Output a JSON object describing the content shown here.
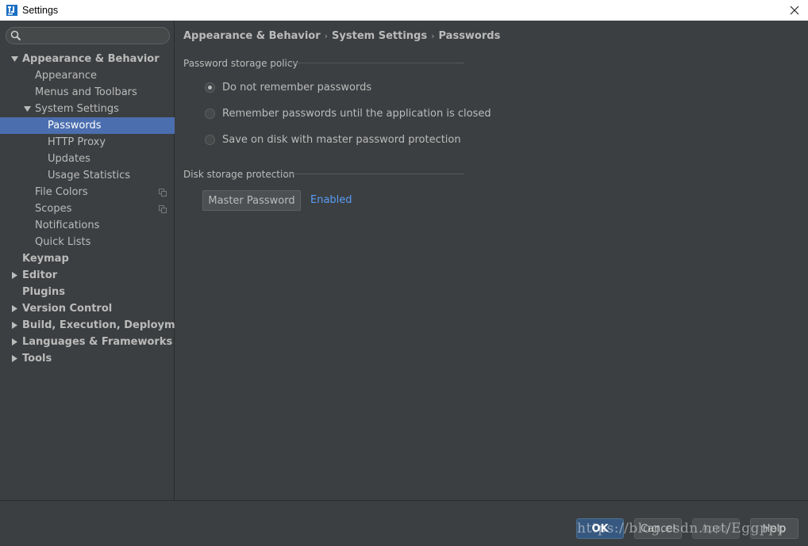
{
  "window": {
    "title": "Settings",
    "logo_icon": "intellij-logo-icon",
    "close_icon": "close-icon"
  },
  "sidebar": {
    "search_placeholder": "",
    "search_icon": "search-icon",
    "items": [
      {
        "label": "Appearance & Behavior",
        "level": 0,
        "bold": true,
        "arrow": "expanded"
      },
      {
        "label": "Appearance",
        "level": 1
      },
      {
        "label": "Menus and Toolbars",
        "level": 1
      },
      {
        "label": "System Settings",
        "level": 1,
        "arrow": "expanded"
      },
      {
        "label": "Passwords",
        "level": 2,
        "selected": true
      },
      {
        "label": "HTTP Proxy",
        "level": 2
      },
      {
        "label": "Updates",
        "level": 2
      },
      {
        "label": "Usage Statistics",
        "level": 2
      },
      {
        "label": "File Colors",
        "level": 1,
        "copy_icon": true
      },
      {
        "label": "Scopes",
        "level": 1,
        "copy_icon": true
      },
      {
        "label": "Notifications",
        "level": 1
      },
      {
        "label": "Quick Lists",
        "level": 1
      },
      {
        "label": "Keymap",
        "level": 0,
        "bold": true
      },
      {
        "label": "Editor",
        "level": 0,
        "bold": true,
        "arrow": "collapsed"
      },
      {
        "label": "Plugins",
        "level": 0,
        "bold": true
      },
      {
        "label": "Version Control",
        "level": 0,
        "bold": true,
        "arrow": "collapsed"
      },
      {
        "label": "Build, Execution, Deployment",
        "level": 0,
        "bold": true,
        "arrow": "collapsed"
      },
      {
        "label": "Languages & Frameworks",
        "level": 0,
        "bold": true,
        "arrow": "collapsed"
      },
      {
        "label": "Tools",
        "level": 0,
        "bold": true,
        "arrow": "collapsed"
      }
    ]
  },
  "breadcrumb": {
    "items": [
      "Appearance & Behavior",
      "System Settings",
      "Passwords"
    ],
    "separator": "›"
  },
  "password_policy": {
    "title": "Password storage policy",
    "options": [
      {
        "label": "Do not remember passwords",
        "checked": true
      },
      {
        "label": "Remember passwords until the application is closed",
        "checked": false
      },
      {
        "label": "Save on disk with master password protection",
        "checked": false
      }
    ]
  },
  "disk_protection": {
    "title": "Disk storage protection",
    "button_label": "Master Password",
    "status_link": "Enabled"
  },
  "footer": {
    "ok_label": "OK",
    "cancel_label": "Cancel",
    "apply_label": "Apply",
    "help_label": "Help",
    "watermark": "https://blog.csdn.net/Eggppp"
  },
  "colors": {
    "background": "#3c3f41",
    "selection": "#4b6eaf",
    "link": "#589df6",
    "text": "#bbbbbb",
    "ok_button": "#365880"
  }
}
